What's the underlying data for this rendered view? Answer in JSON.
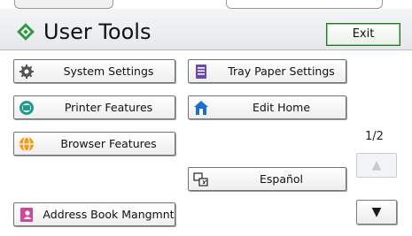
{
  "header": {
    "title": "User Tools",
    "exit_label": "Exit"
  },
  "buttons": {
    "system_settings": "System Settings",
    "tray_paper_settings": "Tray Paper Settings",
    "printer_features": "Printer Features",
    "edit_home": "Edit Home",
    "browser_features": "Browser Features",
    "espanol": "Español",
    "address_book": "Address Book Mangmnt"
  },
  "pagination": {
    "page": "1/2",
    "up": "▲",
    "down": "▼"
  },
  "colors": {
    "title_icon": "#2e9b3e",
    "system_icon": "#555555",
    "tray_icon": "#6b46b8",
    "printer_icon": "#1f9a8a",
    "home_icon": "#1b6fd1",
    "browser_icon": "#f39a1c",
    "address_icon": "#d1469a"
  }
}
